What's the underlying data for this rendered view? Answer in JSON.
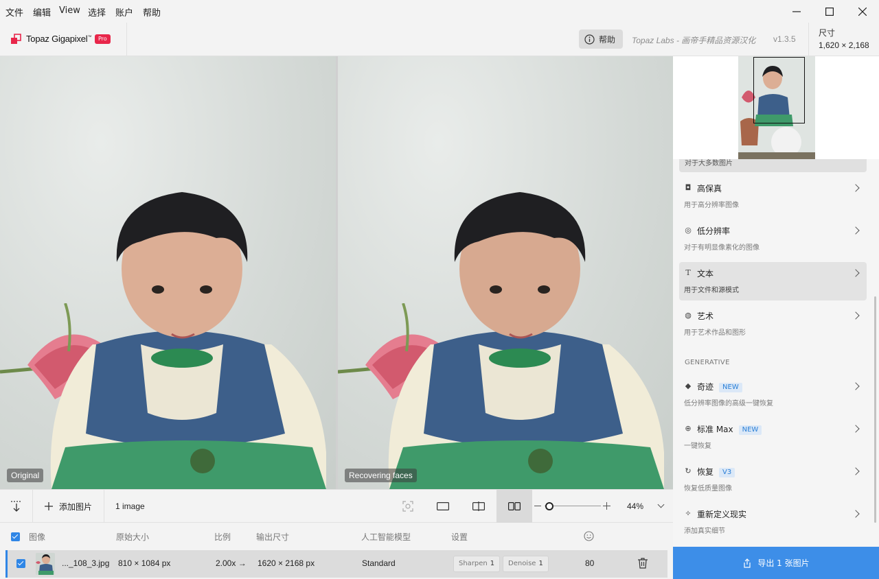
{
  "menu": [
    "文件",
    "编辑",
    "View",
    "选择",
    "账户",
    "帮助"
  ],
  "header": {
    "app_name": "Topaz Gigapixel",
    "app_tm": "™",
    "pro_badge": "Pro",
    "help_label": "帮助",
    "credit": "Topaz Labs - 画帝手精品资源汉化",
    "version": "v1.3.5",
    "size_label": "尺寸",
    "size_value": "1,620 × 2,168"
  },
  "preview": {
    "left_label": "Original",
    "right_label": "Recovering faces"
  },
  "models": {
    "cut_desc": "对于大多数图片",
    "items": [
      {
        "name": "高保真",
        "desc": "用于高分辨率图像",
        "icon": "camera-icon",
        "tag": ""
      },
      {
        "name": "低分辨率",
        "desc": "对于有明显像素化的图像",
        "icon": "lowres-icon",
        "tag": ""
      },
      {
        "name": "文本",
        "desc": "用于文件和源模式",
        "icon": "text-icon",
        "tag": ""
      },
      {
        "name": "艺术",
        "desc": "用于艺术作品和图形",
        "icon": "palette-icon",
        "tag": ""
      }
    ],
    "generative_label": "GENERATIVE",
    "generative": [
      {
        "name": "奇迹",
        "desc": "低分辨率图像的高级一键恢复",
        "icon": "gem-icon",
        "tag": "NEW"
      },
      {
        "name": "标准 Max",
        "desc": "一键恢复",
        "icon": "zoom-icon",
        "tag": "NEW"
      },
      {
        "name": "恢复",
        "desc": "恢复低质量图像",
        "icon": "recover-icon",
        "tag": "V3"
      },
      {
        "name": "重新定义现实",
        "desc": "添加真实细节",
        "icon": "sparkle-icon",
        "tag": ""
      }
    ],
    "active_index": 2
  },
  "export": {
    "label": "导出 1 张图片"
  },
  "toolbar": {
    "add_label": "添加图片",
    "image_count": "1 image",
    "zoom_value": "44%",
    "zoom_level": 0.44
  },
  "table": {
    "headers": {
      "image": "图像",
      "original": "原始大小",
      "scale": "比例",
      "output": "输出尺寸",
      "model": "人工智能模型",
      "settings": "设置"
    },
    "row": {
      "filename": "..._108_3.jpg",
      "original_size": "810 × 1084 px",
      "scale": "2.00x",
      "arrow": "→",
      "output_size": "1620 × 2168 px",
      "model": "Standard",
      "sharpen_label": "Sharpen",
      "sharpen_value": "1",
      "denoise_label": "Denoise",
      "denoise_value": "1",
      "face_value": "80"
    }
  },
  "colors": {
    "accent": "#3d8ee8",
    "pro_badge": "#e8264a",
    "new_tag_bg": "#dbe8f7",
    "new_tag_text": "#2a7fd6"
  }
}
